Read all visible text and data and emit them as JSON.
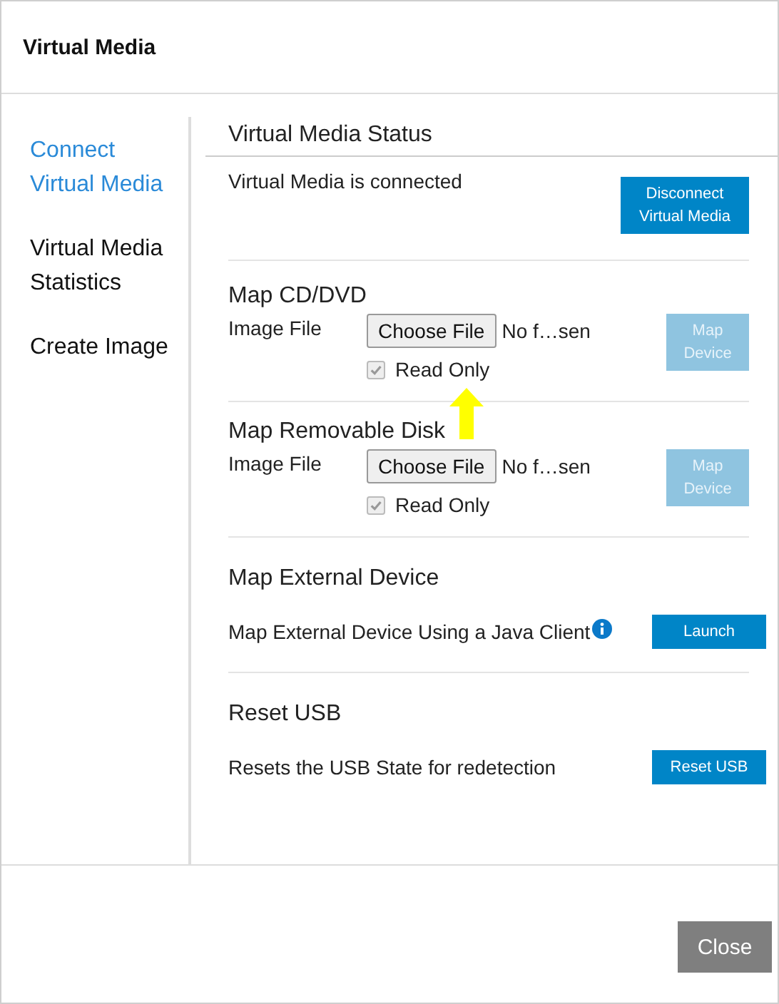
{
  "dialog": {
    "title": "Virtual Media"
  },
  "sidebar": {
    "items": [
      {
        "label": "Connect Virtual Media",
        "selected": true
      },
      {
        "label": "Virtual Media Statistics",
        "selected": false
      },
      {
        "label": "Create Image",
        "selected": false
      }
    ]
  },
  "sections": [
    {
      "kind": "status",
      "heading": "Virtual Media Status",
      "text": "Virtual Media is connected",
      "button": {
        "label": "Disconnect Virtual Media",
        "disabled": false
      }
    },
    {
      "kind": "map",
      "heading": "Map CD/DVD",
      "field_label": "Image File",
      "file_button": "Choose File",
      "file_status": "No f…sen",
      "read_only": {
        "label": "Read Only",
        "checked": true,
        "disabled": true
      },
      "button": {
        "label": "Map Device",
        "disabled": true
      },
      "annotation": true
    },
    {
      "kind": "map",
      "heading": "Map Removable Disk",
      "field_label": "Image File",
      "file_button": "Choose File",
      "file_status": "No f…sen",
      "read_only": {
        "label": "Read Only",
        "checked": true,
        "disabled": true
      },
      "button": {
        "label": "Map Device",
        "disabled": true
      },
      "annotation": false
    },
    {
      "kind": "action",
      "heading": "Map External Device",
      "text": "Map External Device Using a Java Client",
      "info": true,
      "button": {
        "label": "Launch",
        "disabled": false
      }
    },
    {
      "kind": "action",
      "heading": "Reset USB",
      "text": "Resets the USB State for redetection",
      "info": false,
      "button": {
        "label": "Reset USB",
        "disabled": false
      }
    }
  ],
  "footer": {
    "close_button": "Close"
  }
}
